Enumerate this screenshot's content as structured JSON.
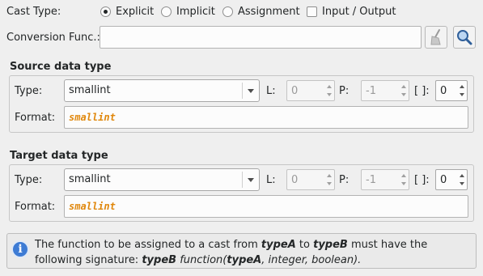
{
  "cast_type": {
    "label": "Cast Type:",
    "options": [
      {
        "label": "Explicit",
        "selected": true
      },
      {
        "label": "Implicit",
        "selected": false
      },
      {
        "label": "Assignment",
        "selected": false
      }
    ],
    "checkbox": {
      "label": "Input / Output",
      "checked": false
    }
  },
  "conversion": {
    "label": "Conversion Func.:",
    "value": "",
    "clear_icon": "broom-icon",
    "search_icon": "magnifier-icon"
  },
  "source": {
    "title": "Source data type",
    "type_label": "Type:",
    "type_value": "smallint",
    "l_label": "L:",
    "l_value": "0",
    "p_label": "P:",
    "p_value": "-1",
    "dim_label": "[ ]:",
    "dim_value": "0",
    "format_label": "Format:",
    "format_value": "smallint"
  },
  "target": {
    "title": "Target data type",
    "type_label": "Type:",
    "type_value": "smallint",
    "l_label": "L:",
    "l_value": "0",
    "p_label": "P:",
    "p_value": "-1",
    "dim_label": "[ ]:",
    "dim_value": "0",
    "format_label": "Format:",
    "format_value": "smallint"
  },
  "info": {
    "icon": "info-icon",
    "t1": "The function to be assigned to a cast from ",
    "t2": "typeA",
    "t3": " to ",
    "t4": "typeB",
    "t5": " must have the following signature: ",
    "t6": "typeB",
    "t7": " function(",
    "t8": "typeA",
    "t9": ", integer, boolean)."
  },
  "colors": {
    "format_text": "#e0870b",
    "info_icon": "#3d7bd4"
  }
}
